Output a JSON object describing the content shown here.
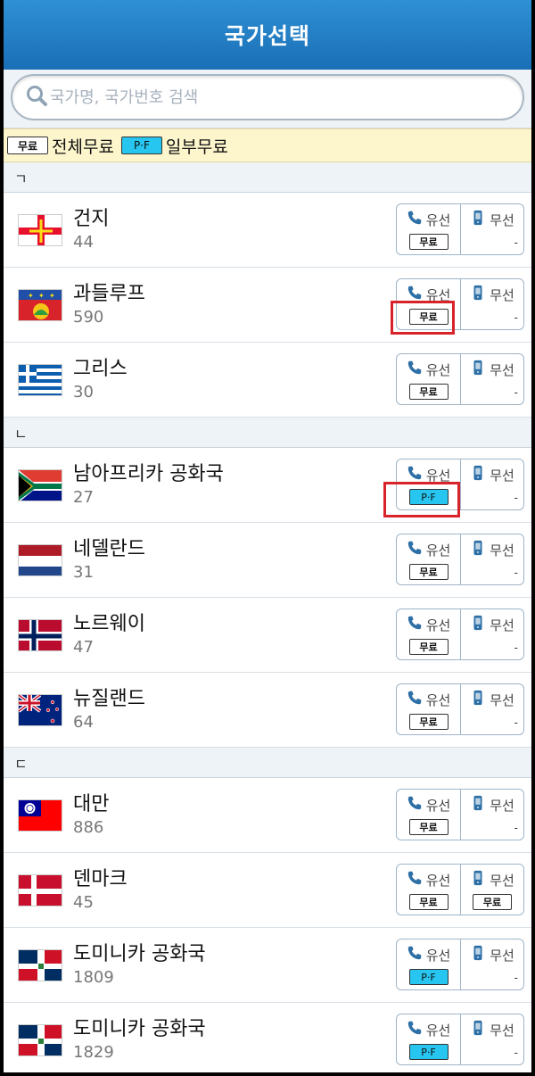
{
  "header": {
    "title": "국가선택"
  },
  "search": {
    "placeholder": "국가명, 국가번호 검색"
  },
  "legend": {
    "free_badge": "무료",
    "free_label": "전체무료",
    "pf_badge": "P·F",
    "pf_label": "일부무료"
  },
  "options": {
    "wired_label": "유선",
    "wireless_label": "무선",
    "none": "-"
  },
  "sections": [
    {
      "header": "ㄱ",
      "rows": [
        {
          "name": "건지",
          "code": "44",
          "flag": "guernsey",
          "wired": "무료",
          "wireless": "-"
        },
        {
          "name": "과들루프",
          "code": "590",
          "flag": "guadeloupe",
          "wired": "무료",
          "wireless": "-"
        },
        {
          "name": "그리스",
          "code": "30",
          "flag": "greece",
          "wired": "무료",
          "wireless": "-"
        }
      ]
    },
    {
      "header": "ㄴ",
      "rows": [
        {
          "name": "남아프리카 공화국",
          "code": "27",
          "flag": "south-africa",
          "wired": "P·F",
          "wireless": "-"
        },
        {
          "name": "네델란드",
          "code": "31",
          "flag": "netherlands",
          "wired": "무료",
          "wireless": "-"
        },
        {
          "name": "노르웨이",
          "code": "47",
          "flag": "norway",
          "wired": "무료",
          "wireless": "-"
        },
        {
          "name": "뉴질랜드",
          "code": "64",
          "flag": "new-zealand",
          "wired": "무료",
          "wireless": "-"
        }
      ]
    },
    {
      "header": "ㄷ",
      "rows": [
        {
          "name": "대만",
          "code": "886",
          "flag": "taiwan",
          "wired": "무료",
          "wireless": "-"
        },
        {
          "name": "덴마크",
          "code": "45",
          "flag": "denmark",
          "wired": "무료",
          "wireless": "무료"
        },
        {
          "name": "도미니카 공화국",
          "code": "1809",
          "flag": "dominican-republic",
          "wired": "P·F",
          "wireless": "-"
        },
        {
          "name": "도미니카 공화국",
          "code": "1829",
          "flag": "dominican-republic",
          "wired": "P·F",
          "wireless": "-"
        }
      ]
    }
  ],
  "colors": {
    "header": "#1a6fb5",
    "pf_badge": "#27c6f0",
    "highlight": "#d8232a",
    "legend_bg": "#fdf6cd"
  }
}
